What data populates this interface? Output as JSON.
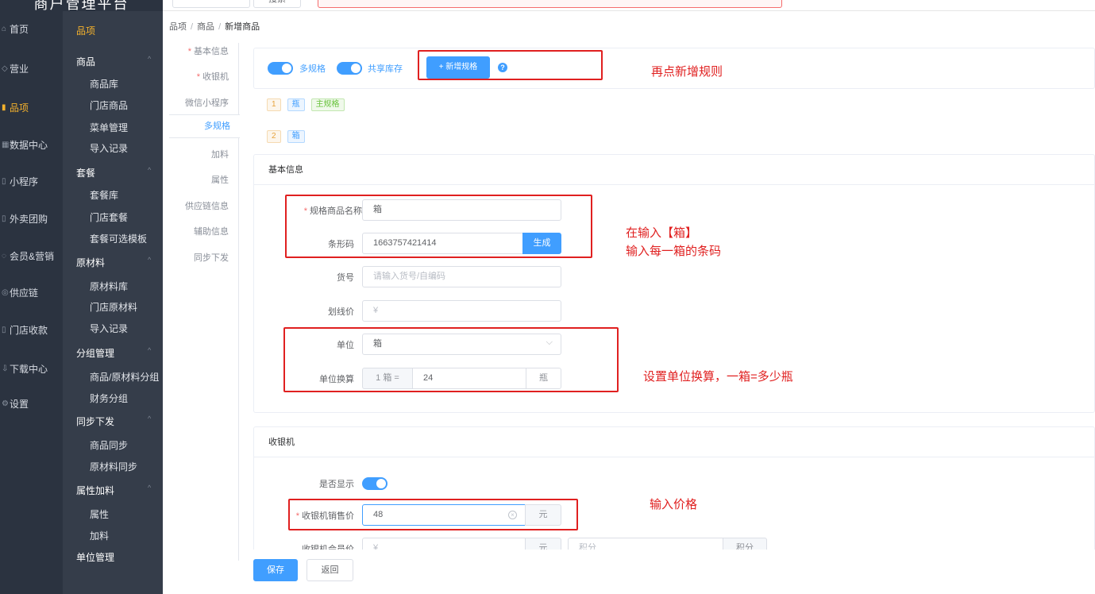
{
  "brand": "商户管理平台",
  "nav": [
    {
      "label": "首页",
      "icon": "home-icon"
    },
    {
      "label": "营业",
      "icon": "shop-icon"
    },
    {
      "label": "品项",
      "icon": "goods-icon",
      "active": true
    },
    {
      "label": "数据中心",
      "icon": "chart-icon"
    },
    {
      "label": "小程序",
      "icon": "miniapp-icon"
    },
    {
      "label": "外卖团购",
      "icon": "takeout-icon"
    },
    {
      "label": "会员&营销",
      "icon": "member-icon"
    },
    {
      "label": "供应链",
      "icon": "supply-icon"
    },
    {
      "label": "门店收款",
      "icon": "cashier-icon"
    },
    {
      "label": "下载中心",
      "icon": "download-icon"
    },
    {
      "label": "设置",
      "icon": "settings-icon"
    }
  ],
  "subnav": {
    "title": "品项",
    "groups": [
      {
        "label": "商品",
        "items": [
          "商品库",
          "门店商品",
          "菜单管理",
          "导入记录"
        ]
      },
      {
        "label": "套餐",
        "items": [
          "套餐库",
          "门店套餐",
          "套餐可选模板"
        ]
      },
      {
        "label": "原材料",
        "items": [
          "原材料库",
          "门店原材料",
          "导入记录"
        ]
      },
      {
        "label": "分组管理",
        "items": [
          "商品/原材料分组",
          "财务分组"
        ]
      },
      {
        "label": "同步下发",
        "items": [
          "商品同步",
          "原材料同步"
        ]
      },
      {
        "label": "属性加料",
        "items": [
          "属性",
          "加料"
        ]
      },
      {
        "label": "单位管理",
        "items": []
      }
    ]
  },
  "topbar": {
    "button": "搜索"
  },
  "breadcrumb": [
    "品项",
    "商品",
    "新增商品"
  ],
  "tabs": [
    {
      "label": "基本信息",
      "required": true
    },
    {
      "label": "收银机",
      "required": true
    },
    {
      "label": "微信小程序"
    },
    {
      "label": "多规格",
      "active": true
    },
    {
      "label": "加料"
    },
    {
      "label": "属性"
    },
    {
      "label": "供应链信息"
    },
    {
      "label": "辅助信息"
    },
    {
      "label": "同步下发"
    }
  ],
  "spec_toolbar": {
    "multi_spec": "多规格",
    "shared_stock": "共享库存",
    "add_spec_button": "+ 新增规格",
    "help": "?"
  },
  "spec_rows": [
    {
      "index": "1",
      "name": "瓶",
      "badge": "主规格"
    },
    {
      "index": "2",
      "name": "箱"
    }
  ],
  "basic_info": {
    "title": "基本信息",
    "spec_name_label": "规格商品名称",
    "spec_name_value": "箱",
    "barcode_label": "条形码",
    "barcode_value": "1663757421414",
    "generate_button": "生成",
    "sku_label": "货号",
    "sku_placeholder": "请输入货号/自编码",
    "list_price_label": "划线价",
    "list_price_placeholder": "¥",
    "unit_label": "单位",
    "unit_value": "箱",
    "unit_chevron": "⌵",
    "conversion_label": "单位换算",
    "conversion_prefix": "1 箱 =",
    "conversion_value": "24",
    "conversion_suffix": "瓶"
  },
  "cashier": {
    "title": "收银机",
    "show_label": "是否显示",
    "price_label": "收银机销售价",
    "price_value": "48",
    "price_unit": "元",
    "member_price_label": "收银机会员价",
    "member_price_placeholder": "¥",
    "member_price_unit": "元",
    "points_placeholder": "积分",
    "points_unit": "积分"
  },
  "annotations": {
    "add_rule": "再点新增规则",
    "barcode_line1": "在输入【箱】",
    "barcode_line2": "输入每一箱的条码",
    "unit_conv": "设置单位换算，一箱=多少瓶",
    "price": "输入价格"
  },
  "footer": {
    "save": "保存",
    "back": "返回"
  },
  "colors": {
    "primary": "#409eff",
    "sidebar": "#2b3340",
    "highlight": "#f5b22c",
    "annotation": "#e02020"
  }
}
